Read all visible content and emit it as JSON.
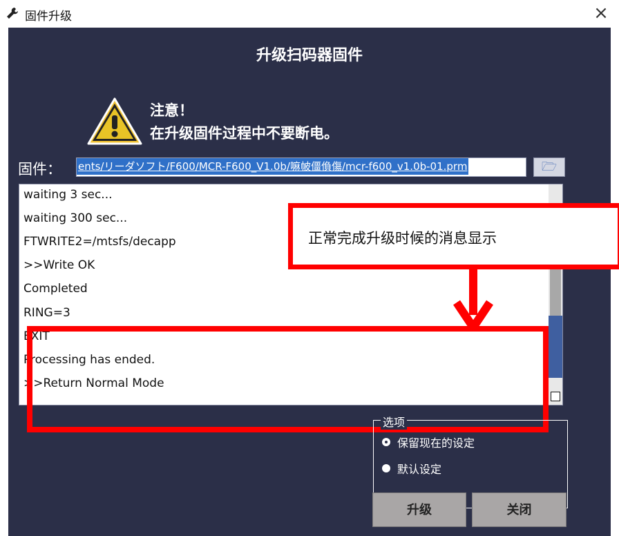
{
  "window": {
    "title": "固件升级",
    "close_label": "×"
  },
  "header": {
    "title": "升级扫码器固件"
  },
  "warning": {
    "line1": "注意！",
    "line2": "在升级固件过程中不要断电。"
  },
  "firmware": {
    "label": "固件：",
    "path": "ents/リーダソフト/F600/MCR-F600_V1.0b/嘛帔僵偩傷/mcr-f600_v1.0b-01.prm"
  },
  "log": {
    "lines": [
      "waiting 3 sec...",
      "waiting 300 sec...",
      "FTWRITE2=/mtsfs/decapp",
      ">>Write OK",
      "Completed",
      "RING=3",
      "EXIT",
      "Processing has ended.",
      ">>Return Normal Mode"
    ]
  },
  "callout": {
    "text": "正常完成升级时候的消息显示"
  },
  "options": {
    "legend": "选项",
    "items": [
      {
        "label": "保留现在的设定",
        "selected": true
      },
      {
        "label": "默认设定",
        "selected": false
      }
    ]
  },
  "buttons": {
    "upgrade": "升级",
    "close": "关闭"
  },
  "colors": {
    "panel": "#2b2f48",
    "highlight": "#ff0000",
    "button": "#a9a6a6"
  }
}
